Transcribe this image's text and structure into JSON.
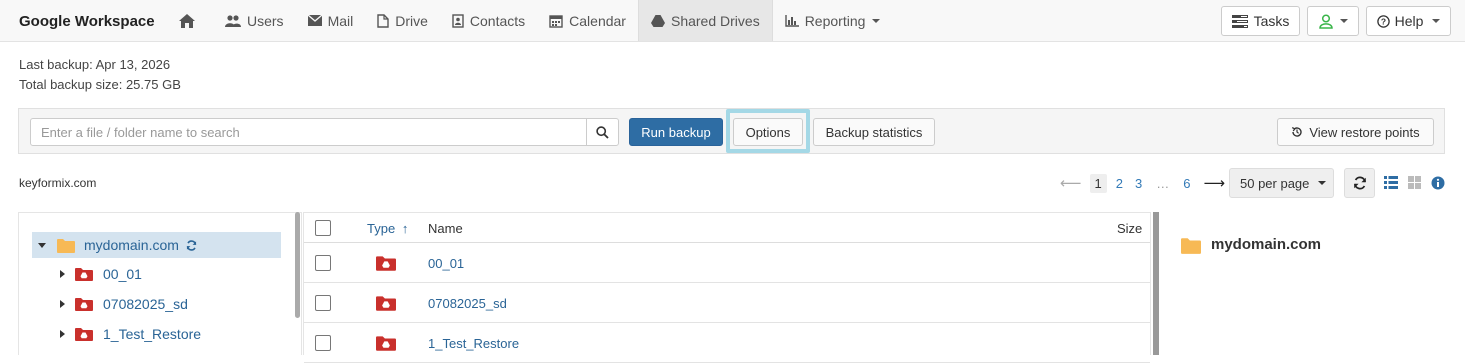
{
  "app": {
    "brand": "Google Workspace"
  },
  "nav": {
    "items": [
      {
        "key": "home",
        "label": "",
        "icon": "home-icon"
      },
      {
        "key": "users",
        "label": "Users",
        "icon": "users-icon"
      },
      {
        "key": "mail",
        "label": "Mail",
        "icon": "mail-icon"
      },
      {
        "key": "drive",
        "label": "Drive",
        "icon": "file-icon"
      },
      {
        "key": "contacts",
        "label": "Contacts",
        "icon": "contact-card-icon"
      },
      {
        "key": "calendar",
        "label": "Calendar",
        "icon": "calendar-icon"
      },
      {
        "key": "shared_drives",
        "label": "Shared Drives",
        "icon": "shared-drive-icon",
        "active": true
      },
      {
        "key": "reporting",
        "label": "Reporting",
        "icon": "bar-chart-icon",
        "dropdown": true
      }
    ],
    "tasks_label": "Tasks",
    "help_label": "Help"
  },
  "backup": {
    "last": "Last backup: Apr 13, 2026",
    "size": "Total backup size: 25.75 GB"
  },
  "toolbar": {
    "search_placeholder": "Enter a file / folder name to search",
    "run_backup": "Run backup",
    "options": "Options",
    "stats": "Backup statistics",
    "restore_points": "View restore points"
  },
  "listing": {
    "domain": "keyformix.com",
    "pages": [
      "1",
      "2",
      "3",
      "…",
      "6"
    ],
    "current_page": "1",
    "per_page": "50 per page"
  },
  "tree": {
    "root": "mydomain.com",
    "children": [
      "00_01",
      "07082025_sd",
      "1_Test_Restore"
    ]
  },
  "table": {
    "headers": {
      "type": "Type",
      "name": "Name",
      "size": "Size"
    },
    "rows": [
      {
        "name": "00_01"
      },
      {
        "name": "07082025_sd"
      },
      {
        "name": "1_Test_Restore"
      }
    ]
  },
  "details": {
    "title": "mydomain.com"
  },
  "colors": {
    "primary": "#2e6da4",
    "link": "#2a6496",
    "drive_red": "#c9302c",
    "folder": "#f0ad4e",
    "focus": "#a4d8e6"
  }
}
